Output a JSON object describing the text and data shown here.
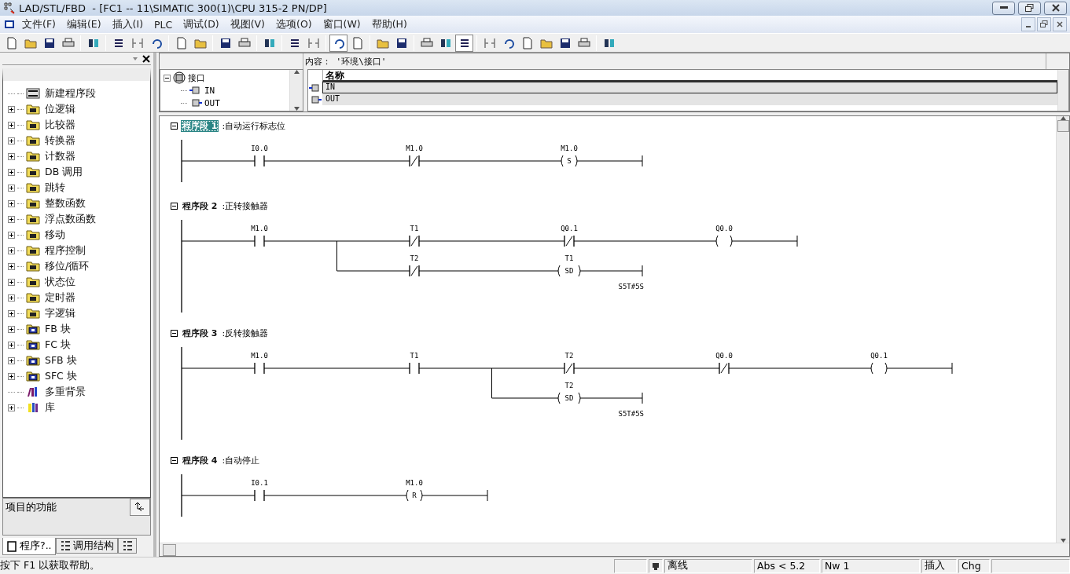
{
  "window": {
    "title": "LAD/STL/FBD  - [FC1 -- 11\\SIMATIC 300(1)\\CPU 315-2 PN/DP]"
  },
  "menu": [
    "文件(F)",
    "编辑(E)",
    "插入(I)",
    "PLC",
    "调试(D)",
    "视图(V)",
    "选项(O)",
    "窗口(W)",
    "帮助(H)"
  ],
  "sidebar": {
    "items": [
      {
        "label": "新建程序段",
        "kind": "command"
      },
      {
        "label": "位逻辑",
        "kind": "folder",
        "expanded": false
      },
      {
        "label": "比较器",
        "kind": "folder",
        "expanded": false
      },
      {
        "label": "转换器",
        "kind": "folder",
        "expanded": false
      },
      {
        "label": "计数器",
        "kind": "folder",
        "expanded": false
      },
      {
        "label": "DB 调用",
        "kind": "folder",
        "expanded": false
      },
      {
        "label": "跳转",
        "kind": "folder",
        "expanded": false
      },
      {
        "label": "整数函数",
        "kind": "folder",
        "expanded": false
      },
      {
        "label": "浮点数函数",
        "kind": "folder",
        "expanded": false
      },
      {
        "label": "移动",
        "kind": "folder",
        "expanded": false
      },
      {
        "label": "程序控制",
        "kind": "folder",
        "expanded": false
      },
      {
        "label": "移位/循环",
        "kind": "folder",
        "expanded": false
      },
      {
        "label": "状态位",
        "kind": "folder",
        "expanded": false
      },
      {
        "label": "定时器",
        "kind": "folder",
        "expanded": false
      },
      {
        "label": "字逻辑",
        "kind": "folder",
        "expanded": false
      },
      {
        "label": "FB 块",
        "kind": "block",
        "expanded": false
      },
      {
        "label": "FC 块",
        "kind": "block",
        "expanded": false
      },
      {
        "label": "SFB 块",
        "kind": "block",
        "expanded": false
      },
      {
        "label": "SFC 块",
        "kind": "block",
        "expanded": false
      },
      {
        "label": "多重背景",
        "kind": "instances"
      },
      {
        "label": "库",
        "kind": "library",
        "expanded": false
      }
    ],
    "description": "项目的功能",
    "tabs": [
      {
        "label": "程序?..",
        "selected": true
      },
      {
        "label": "调用结构",
        "selected": false
      },
      {
        "selected": false
      }
    ]
  },
  "interface": {
    "caption": "内容： '环境\\接口'",
    "tree": [
      {
        "label": "接口",
        "expanded": true,
        "children": [
          {
            "label": "IN"
          },
          {
            "label": "OUT"
          }
        ]
      }
    ],
    "table": {
      "columns": [
        "名称"
      ],
      "rows": [
        {
          "name": "IN",
          "selected": true
        },
        {
          "name": "OUT",
          "selected": false
        }
      ]
    }
  },
  "networks": [
    {
      "label": "程序段 1",
      "title": ":自动运行标志位",
      "selected": true,
      "rung": [
        {
          "kind": "no",
          "operand": "I0.0"
        },
        {
          "kind": "nc",
          "operand": "M1.0"
        },
        {
          "kind": "coil",
          "operand": "M1.0",
          "symbol": "S"
        }
      ]
    },
    {
      "label": "程序段 2",
      "title": ":正转接触器",
      "selected": false,
      "rung": [
        {
          "kind": "no",
          "operand": "M1.0"
        },
        {
          "kind": "nc",
          "operand": "T1",
          "parallel": [
            {
              "kind": "nc",
              "operand": "T2"
            },
            {
              "kind": "coil",
              "operand": "T1",
              "symbol": "SD",
              "preset": "S5T#5S"
            }
          ]
        },
        {
          "kind": "nc",
          "operand": "Q0.1"
        },
        {
          "kind": "coil",
          "operand": "Q0.0"
        }
      ]
    },
    {
      "label": "程序段 3",
      "title": ":反转接触器",
      "selected": false,
      "rung": [
        {
          "kind": "no",
          "operand": "M1.0"
        },
        {
          "kind": "no",
          "operand": "T1"
        },
        {
          "kind": "nc",
          "operand": "T2",
          "parallel": [
            {
              "kind": "coil",
              "operand": "T2",
              "symbol": "SD",
              "preset": "S5T#5S"
            }
          ]
        },
        {
          "kind": "nc",
          "operand": "Q0.0"
        },
        {
          "kind": "coil",
          "operand": "Q0.1"
        }
      ]
    },
    {
      "label": "程序段 4",
      "title": ":自动停止",
      "selected": false,
      "rung": [
        {
          "kind": "no",
          "operand": "I0.1"
        },
        {
          "kind": "coil",
          "operand": "M1.0",
          "symbol": "R"
        }
      ]
    }
  ],
  "status_bar": {
    "help": "按下 F1 以获取帮助。",
    "mode": "离线",
    "abs": "Abs < 5.2",
    "network": "Nw 1",
    "insert": "插入",
    "change": "Chg"
  }
}
